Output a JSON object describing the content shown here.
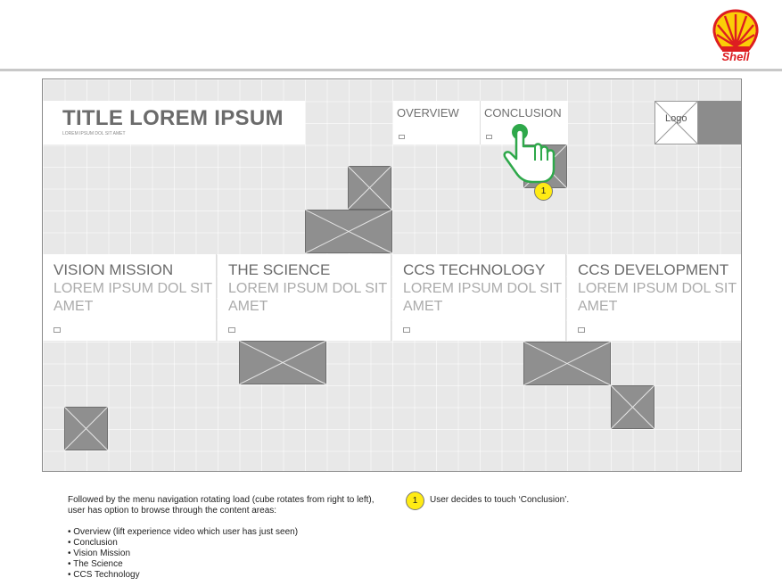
{
  "brand": {
    "logo_text": "Shell",
    "colors": {
      "red": "#dd1d21",
      "yellow": "#fbce07"
    }
  },
  "screen": {
    "title": "TITLE LOREM IPSUM",
    "subtitle": "LOREM IPSUM DOL SIT AMET",
    "nav": [
      {
        "label": "OVERVIEW"
      },
      {
        "label": "CONCLUSION"
      }
    ],
    "logo_placeholder": "Logo",
    "cards": [
      {
        "title": "VISION MISSION",
        "body": "LOREM IPSUM DOL SIT AMET"
      },
      {
        "title": "THE SCIENCE",
        "body": "LOREM IPSUM DOL SIT AMET"
      },
      {
        "title": "CCS TECHNOLOGY",
        "body": "LOREM IPSUM DOL SIT AMET"
      },
      {
        "title": "CCS DEVELOPMENT",
        "body": "LOREM IPSUM DOL SIT AMET"
      }
    ],
    "touch_marker": "1",
    "touch_color": "#2ea84a"
  },
  "annotations": {
    "description": "Followed by the menu navigation rotating load (cube rotates from right to left), user has option to browse through the content areas:",
    "bullets": [
      "• Overview (lift experience video which user has just seen)",
      "• Conclusion",
      "• Vision Mission",
      "• The Science",
      "• CCS Technology"
    ],
    "legend": {
      "marker": "1",
      "text": "User decides to touch ‘Conclusion’."
    }
  }
}
